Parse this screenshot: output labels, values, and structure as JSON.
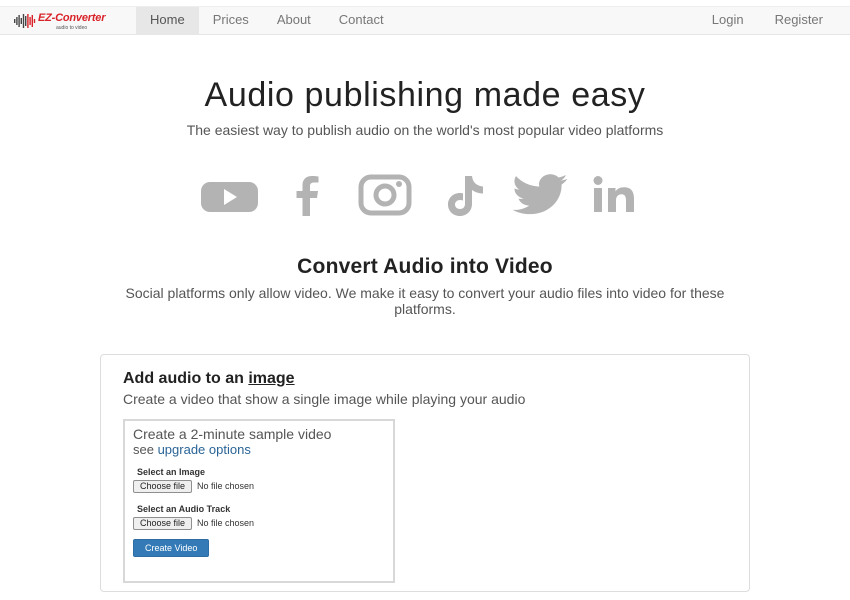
{
  "brand": {
    "name": "EZ-Converter",
    "tagline": "audio to video",
    "color": "#d9232a"
  },
  "nav": {
    "left": [
      "Home",
      "Prices",
      "About",
      "Contact"
    ],
    "right": [
      "Login",
      "Register"
    ],
    "active": "Home"
  },
  "hero": {
    "title": "Audio publishing made easy",
    "subtitle": "The easiest way to publish audio on the world's most popular video platforms",
    "platform_icons": [
      "youtube-icon",
      "facebook-icon",
      "instagram-icon",
      "tiktok-icon",
      "twitter-icon",
      "linkedin-icon"
    ],
    "icon_color": "#b3b3b3"
  },
  "convert": {
    "title": "Convert Audio into Video",
    "subtitle": "Social platforms only allow video. We make it easy to convert your audio files into video for these platforms."
  },
  "panel": {
    "title_prefix": "Add audio to an ",
    "title_link": "image",
    "subtitle": "Create a video that show a single image while playing your audio",
    "sample_text": "Create a 2-minute sample video",
    "see_text": "see ",
    "upgrade_link": "upgrade options",
    "image_label": "Select an Image",
    "audio_label": "Select an Audio Track",
    "choose_file": "Choose file",
    "no_file": "No file chosen",
    "create_button": "Create Video",
    "button_color": "#337ab7"
  }
}
